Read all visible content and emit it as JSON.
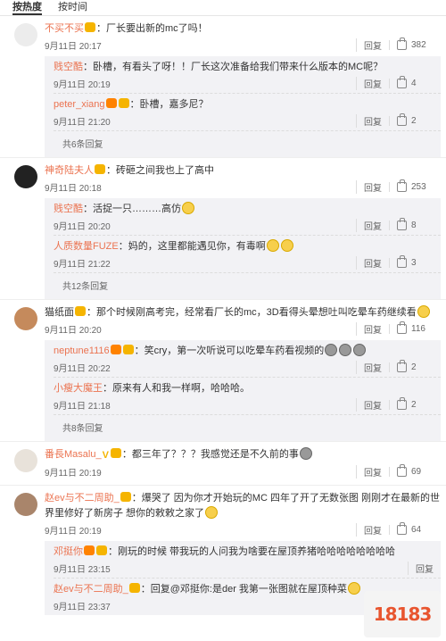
{
  "sort": {
    "hot": "按热度",
    "time": "按时间"
  },
  "actions": {
    "reply": "回复"
  },
  "threads": [
    {
      "user": "不买不买",
      "text": "：厂长要出新的mc了吗！",
      "time": "9月11日 20:17",
      "likes": "382",
      "replies": [
        {
          "user": "贱空酷",
          "text": "：卧槽，有看头了呀！！厂长这次准备给我们带来什么版本的MC呢？",
          "time": "9月11日 20:19",
          "likes": "4"
        },
        {
          "user": "peter_xiang",
          "text": "：卧槽，嘉多尼？",
          "time": "9月11日 21:20",
          "likes": "2"
        }
      ],
      "more": "共6条回复"
    },
    {
      "user": "神奇陆夫人",
      "text": "：砖砸之间我也上了高中",
      "time": "9月11日 20:18",
      "likes": "253",
      "replies": [
        {
          "user": "贱空酷",
          "text": "：活捉一只………高仿",
          "time": "9月11日 20:20",
          "likes": "8"
        },
        {
          "user": "人质数量FUZE",
          "text": "：妈的，这里都能遇见你，有毒啊",
          "time": "9月11日 21:22",
          "likes": "3"
        }
      ],
      "more": "共12条回复"
    },
    {
      "user": "猫纸面",
      "text": "：那个时候刚高考完，经常看厂长的mc，3D看得头晕想吐叫吃晕车药继续看",
      "time": "9月11日 20:20",
      "likes": "116",
      "replies": [
        {
          "user": "neptune1116",
          "text": "：笑cry，第一次听说可以吃晕车药看视频的",
          "time": "9月11日 20:22",
          "likes": "2"
        },
        {
          "user": "小瘦大魔王",
          "text": "：原来有人和我一样啊，哈哈哈。",
          "time": "9月11日 21:18",
          "likes": "2"
        }
      ],
      "more": "共8条回复"
    },
    {
      "user": "番長Masalu_",
      "text": "：都三年了？？？我感觉还是不久前的事",
      "time": "9月11日 20:19",
      "likes": "69",
      "replies": [],
      "more": ""
    },
    {
      "user": "赵ev与不二周助_",
      "text": "：爆哭了 因为你才开始玩的MC 四年了开了无数张图 刚刚才在最新的世界里修好了新房子 想你的敕敕之家了",
      "time": "9月11日 20:19",
      "likes": "64",
      "replies": [
        {
          "user": "邓挺你",
          "text": "：刚玩的时候 带我玩的人问我为啥要在屋顶养猪哈哈哈哈哈哈哈哈",
          "time": "9月11日 23:15",
          "likes": ""
        },
        {
          "user": "赵ev与不二周助_",
          "text": "：回复@邓挺你:是der 我第一张图就在屋顶种菜",
          "time": "9月11日 23:37",
          "likes": ""
        }
      ],
      "more": ""
    }
  ],
  "watermark": "18183",
  "colors": {
    "username": "#eb7350",
    "reply_bg": "#f2f2f5"
  }
}
